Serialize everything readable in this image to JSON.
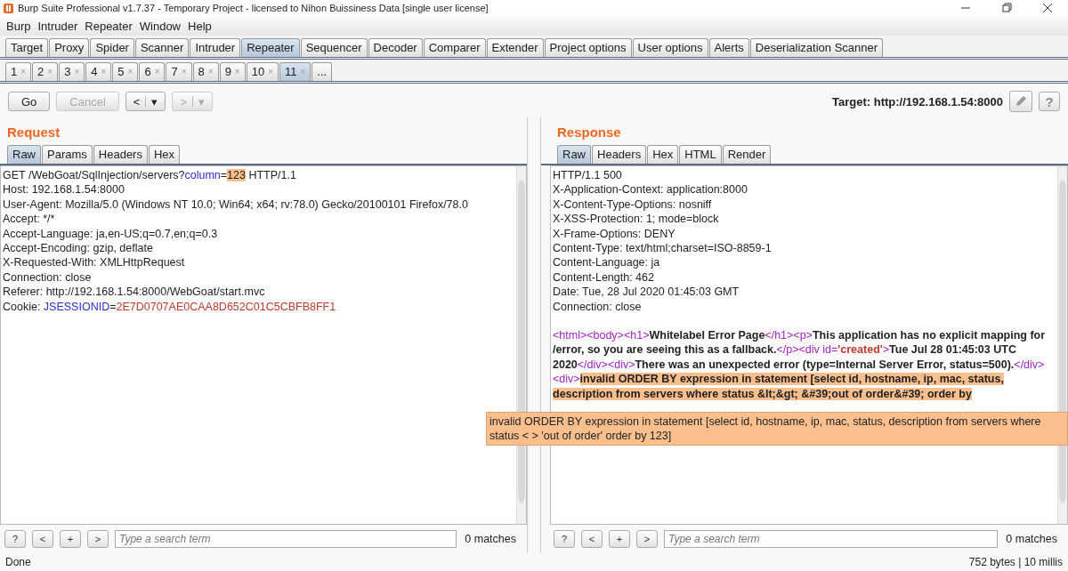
{
  "window": {
    "title": "Burp Suite Professional v1.7.37 - Temporary Project - licensed to Nihon Buissiness Data [single user license]"
  },
  "menu": [
    "Burp",
    "Intruder",
    "Repeater",
    "Window",
    "Help"
  ],
  "tabs": [
    {
      "label": "Target",
      "selected": false
    },
    {
      "label": "Proxy",
      "selected": false
    },
    {
      "label": "Spider",
      "selected": false
    },
    {
      "label": "Scanner",
      "selected": false
    },
    {
      "label": "Intruder",
      "selected": false
    },
    {
      "label": "Repeater",
      "selected": true
    },
    {
      "label": "Sequencer",
      "selected": false
    },
    {
      "label": "Decoder",
      "selected": false
    },
    {
      "label": "Comparer",
      "selected": false
    },
    {
      "label": "Extender",
      "selected": false
    },
    {
      "label": "Project options",
      "selected": false
    },
    {
      "label": "User options",
      "selected": false
    },
    {
      "label": "Alerts",
      "selected": false
    },
    {
      "label": "Deserialization Scanner",
      "selected": false
    }
  ],
  "sub_tabs": [
    {
      "label": "1",
      "close": "×",
      "selected": false
    },
    {
      "label": "2",
      "close": "×",
      "selected": false
    },
    {
      "label": "3",
      "close": "×",
      "selected": false
    },
    {
      "label": "4",
      "close": "×",
      "selected": false
    },
    {
      "label": "5",
      "close": "×",
      "selected": false
    },
    {
      "label": "6",
      "close": "×",
      "selected": false
    },
    {
      "label": "7",
      "close": "×",
      "selected": false
    },
    {
      "label": "8",
      "close": "×",
      "selected": false
    },
    {
      "label": "9",
      "close": "×",
      "selected": false
    },
    {
      "label": "10",
      "close": "×",
      "selected": false
    },
    {
      "label": "11",
      "close": "×",
      "selected": true
    }
  ],
  "more_tab": "...",
  "toolbar": {
    "buttons": [
      {
        "label": "Go",
        "disabled": false
      },
      {
        "label": "Cancel",
        "disabled": true
      }
    ],
    "back": {
      "label": "<",
      "caret": "▾"
    },
    "forward": {
      "label": ">",
      "caret": "▾",
      "disabled": true
    },
    "target": "Target: http://192.168.1.54:8000",
    "help": "?"
  },
  "request": {
    "title": "Request",
    "tabs": [
      {
        "label": "Raw",
        "selected": true
      },
      {
        "label": "Params",
        "selected": false
      },
      {
        "label": "Headers",
        "selected": false
      },
      {
        "label": "Hex",
        "selected": false
      }
    ],
    "lines": [
      [
        {
          "text": "GET /WebGoat/SqlInjection/servers?",
          "kind": "plain"
        },
        {
          "text": "column",
          "kind": "name"
        },
        {
          "text": "=",
          "kind": "plain"
        },
        {
          "text": "123",
          "kind": "mark"
        },
        {
          "text": " HTTP/1.1",
          "kind": "plain"
        }
      ],
      [
        {
          "text": "Host: 192.168.1.54:8000",
          "kind": "plain"
        }
      ],
      [
        {
          "text": "User-Agent: Mozilla/5.0 (Windows NT 10.0; Win64; x64; rv:78.0) Gecko/20100101 Firefox/78.0",
          "kind": "plain"
        }
      ],
      [
        {
          "text": "Accept: */*",
          "kind": "plain"
        }
      ],
      [
        {
          "text": "Accept-Language: ja,en-US;q=0.7,en;q=0.3",
          "kind": "plain"
        }
      ],
      [
        {
          "text": "Accept-Encoding: gzip, deflate",
          "kind": "plain"
        }
      ],
      [
        {
          "text": "X-Requested-With: XMLHttpRequest",
          "kind": "plain"
        }
      ],
      [
        {
          "text": "Connection: close",
          "kind": "plain"
        }
      ],
      [
        {
          "text": "Referer: http://192.168.1.54:8000/WebGoat/start.mvc",
          "kind": "plain"
        }
      ],
      [
        {
          "text": "Cookie: ",
          "kind": "plain"
        },
        {
          "text": "JSESSIONID",
          "kind": "name"
        },
        {
          "text": "=",
          "kind": "plain"
        },
        {
          "text": "2E7D0707AE0CAA8D652C01C5CBFB8FF1",
          "kind": "value"
        }
      ]
    ],
    "search": {
      "help": "?",
      "prev": "<",
      "add": "+",
      "next": ">",
      "placeholder": "Type a search term",
      "matches": "0 matches"
    }
  },
  "response": {
    "title": "Response",
    "tabs": [
      {
        "label": "Raw",
        "selected": true
      },
      {
        "label": "Headers",
        "selected": false
      },
      {
        "label": "Hex",
        "selected": false
      },
      {
        "label": "HTML",
        "selected": false
      },
      {
        "label": "Render",
        "selected": false
      }
    ],
    "headers": [
      "HTTP/1.1 500",
      "X-Application-Context: application:8000",
      "X-Content-Type-Options: nosniff",
      "X-XSS-Protection: 1; mode=block",
      "X-Frame-Options: DENY",
      "Content-Type: text/html;charset=ISO-8859-1",
      "Content-Language: ja",
      "Content-Length: 462",
      "Date: Tue, 28 Jul 2020 01:45:03 GMT",
      "Connection: close"
    ],
    "body": [
      {
        "text": "<html>",
        "kind": "tag"
      },
      {
        "text": "<body>",
        "kind": "tag"
      },
      {
        "text": "<h1>",
        "kind": "tag"
      },
      {
        "text": "Whitelabel Error Page",
        "kind": "text"
      },
      {
        "text": "</h1>",
        "kind": "tag"
      },
      {
        "text": "<p>",
        "kind": "tag"
      },
      {
        "text": "This application has no explicit mapping for /error, so you are seeing this as a fallback.",
        "kind": "text"
      },
      {
        "text": "</p>",
        "kind": "tag"
      },
      {
        "text": "<div id=",
        "kind": "tag"
      },
      {
        "text": "'created'",
        "kind": "value"
      },
      {
        "text": ">",
        "kind": "tag"
      },
      {
        "text": "Tue Jul 28 01:45:03 UTC 2020",
        "kind": "text"
      },
      {
        "text": "</div>",
        "kind": "tag"
      },
      {
        "text": "<div>",
        "kind": "tag"
      },
      {
        "text": "There was an unexpected error (type=Internal Server Error, status=500).",
        "kind": "text"
      },
      {
        "text": "</div>",
        "kind": "tag"
      },
      {
        "text": "<div>",
        "kind": "tag"
      },
      {
        "text": "invalid ORDER BY expression in statement [select id, hostname, ip, mac, status, description from servers  where status &lt;&gt; &#39;out of order&#39; order by",
        "kind": "mark"
      }
    ],
    "tooltip": "invalid ORDER BY expression in statement [select id, hostname, ip, mac, status, description from servers  where status < > 'out of order' order by 123]",
    "search": {
      "help": "?",
      "prev": "<",
      "add": "+",
      "next": ">",
      "placeholder": "Type a search term",
      "matches": "0 matches"
    }
  },
  "status_bar": {
    "left": "Done",
    "right": "752 bytes | 10 millis"
  }
}
